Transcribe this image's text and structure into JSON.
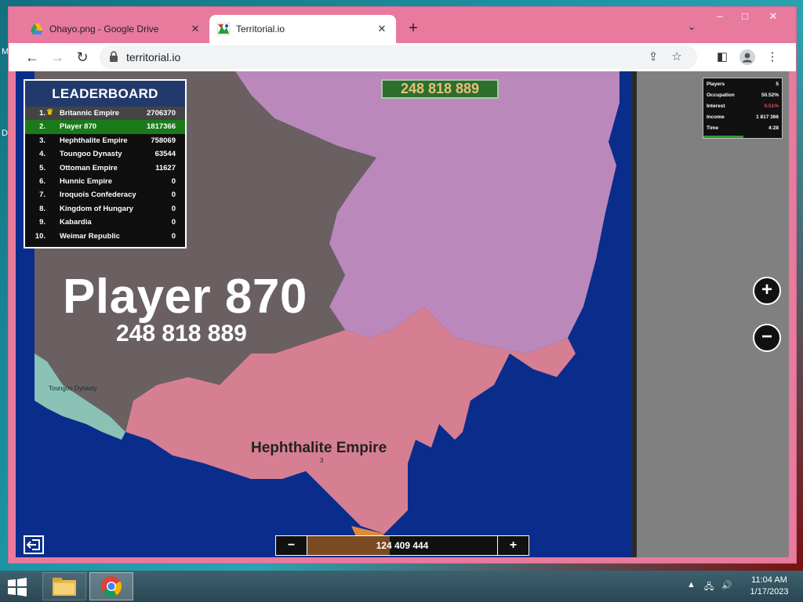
{
  "desktop": {
    "edge_letters": [
      "M",
      "D"
    ]
  },
  "browser": {
    "tabs": [
      {
        "title": "Ohayo.png - Google Drive",
        "icon": "google-drive-icon",
        "active": false
      },
      {
        "title": "Territorial.io",
        "icon": "territorial-favicon",
        "active": true
      }
    ],
    "new_tab": "+",
    "url": "territorial.io"
  },
  "game": {
    "leaderboard": {
      "title": "LEADERBOARD",
      "rows": [
        {
          "rank": "1.",
          "name": "Britannic Empire",
          "score": "2706370",
          "crown": true
        },
        {
          "rank": "2.",
          "name": "Player 870",
          "score": "1817366",
          "highlight": true
        },
        {
          "rank": "3.",
          "name": "Hephthalite Empire",
          "score": "758069"
        },
        {
          "rank": "4.",
          "name": "Toungoo Dynasty",
          "score": "63544"
        },
        {
          "rank": "5.",
          "name": "Ottoman Empire",
          "score": "11627"
        },
        {
          "rank": "6.",
          "name": "Hunnic Empire",
          "score": "0"
        },
        {
          "rank": "7.",
          "name": "Iroquois Confederacy",
          "score": "0"
        },
        {
          "rank": "8.",
          "name": "Kingdom of Hungary",
          "score": "0"
        },
        {
          "rank": "9.",
          "name": "Kabardia",
          "score": "0"
        },
        {
          "rank": "10.",
          "name": "Weimar Republic",
          "score": "0"
        }
      ]
    },
    "top_counter": "248 818 889",
    "stats": [
      {
        "key": "Players",
        "value": "5"
      },
      {
        "key": "Occupation",
        "value": "50.52%"
      },
      {
        "key": "Interest",
        "value": "0.51%",
        "alert": true
      },
      {
        "key": "Income",
        "value": "1 817 366"
      },
      {
        "key": "Time",
        "value": "4:28"
      }
    ],
    "occupation_fraction": 0.5052,
    "player_label": {
      "name": "Player 870",
      "score": "248 818 889"
    },
    "territory_labels": [
      {
        "name": "Hephthalite Empire",
        "sub": "3"
      },
      {
        "name": "Toungoo Dynasty"
      }
    ],
    "zoom_in": "+",
    "zoom_out": "−",
    "troop_selector": {
      "minus": "−",
      "plus": "+",
      "value": "124 409 444",
      "fraction": 0.43
    },
    "colors": {
      "water": "#0a2d8c",
      "player": "#6a6062",
      "purple_territory": "#bb88bb",
      "pink_territory": "#d77f92",
      "teal_territory": "#8ac2b6",
      "side_panel": "#808080"
    }
  },
  "taskbar": {
    "apps": [
      "file-explorer-icon",
      "chrome-icon"
    ],
    "time": "11:04 AM",
    "date": "1/17/2023"
  }
}
